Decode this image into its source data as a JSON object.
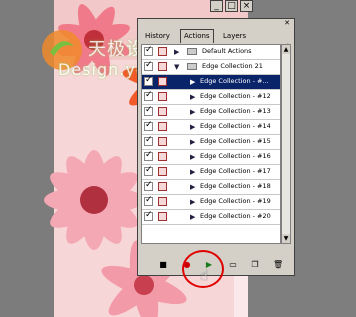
{
  "window_buttons": [
    "_",
    "□",
    "×"
  ],
  "palette": {
    "tabs": [
      "History",
      "Actions",
      "Layers"
    ],
    "active_tab": "Actions",
    "rows": [
      {
        "label": "Default Actions",
        "type": "set",
        "expanded": false
      },
      {
        "label": "Edge Collection 21",
        "type": "set",
        "expanded": true
      },
      {
        "label": "Edge Collection - #...",
        "type": "action",
        "selected": true
      },
      {
        "label": "Edge Collection - #12",
        "type": "action"
      },
      {
        "label": "Edge Collection - #13",
        "type": "action"
      },
      {
        "label": "Edge Collection - #14",
        "type": "action"
      },
      {
        "label": "Edge Collection - #15",
        "type": "action"
      },
      {
        "label": "Edge Collection - #16",
        "type": "action"
      },
      {
        "label": "Edge Collection - #17",
        "type": "action"
      },
      {
        "label": "Edge Collection - #18",
        "type": "action"
      },
      {
        "label": "Edge Collection - #19",
        "type": "action"
      },
      {
        "label": "Edge Collection - #20",
        "type": "action"
      }
    ]
  },
  "watermark": {
    "line1": "天极设计在线",
    "line2": "Design.yesky.com"
  },
  "colors": {
    "selection": "#0a246a",
    "highlight_circle": "#e00000"
  }
}
